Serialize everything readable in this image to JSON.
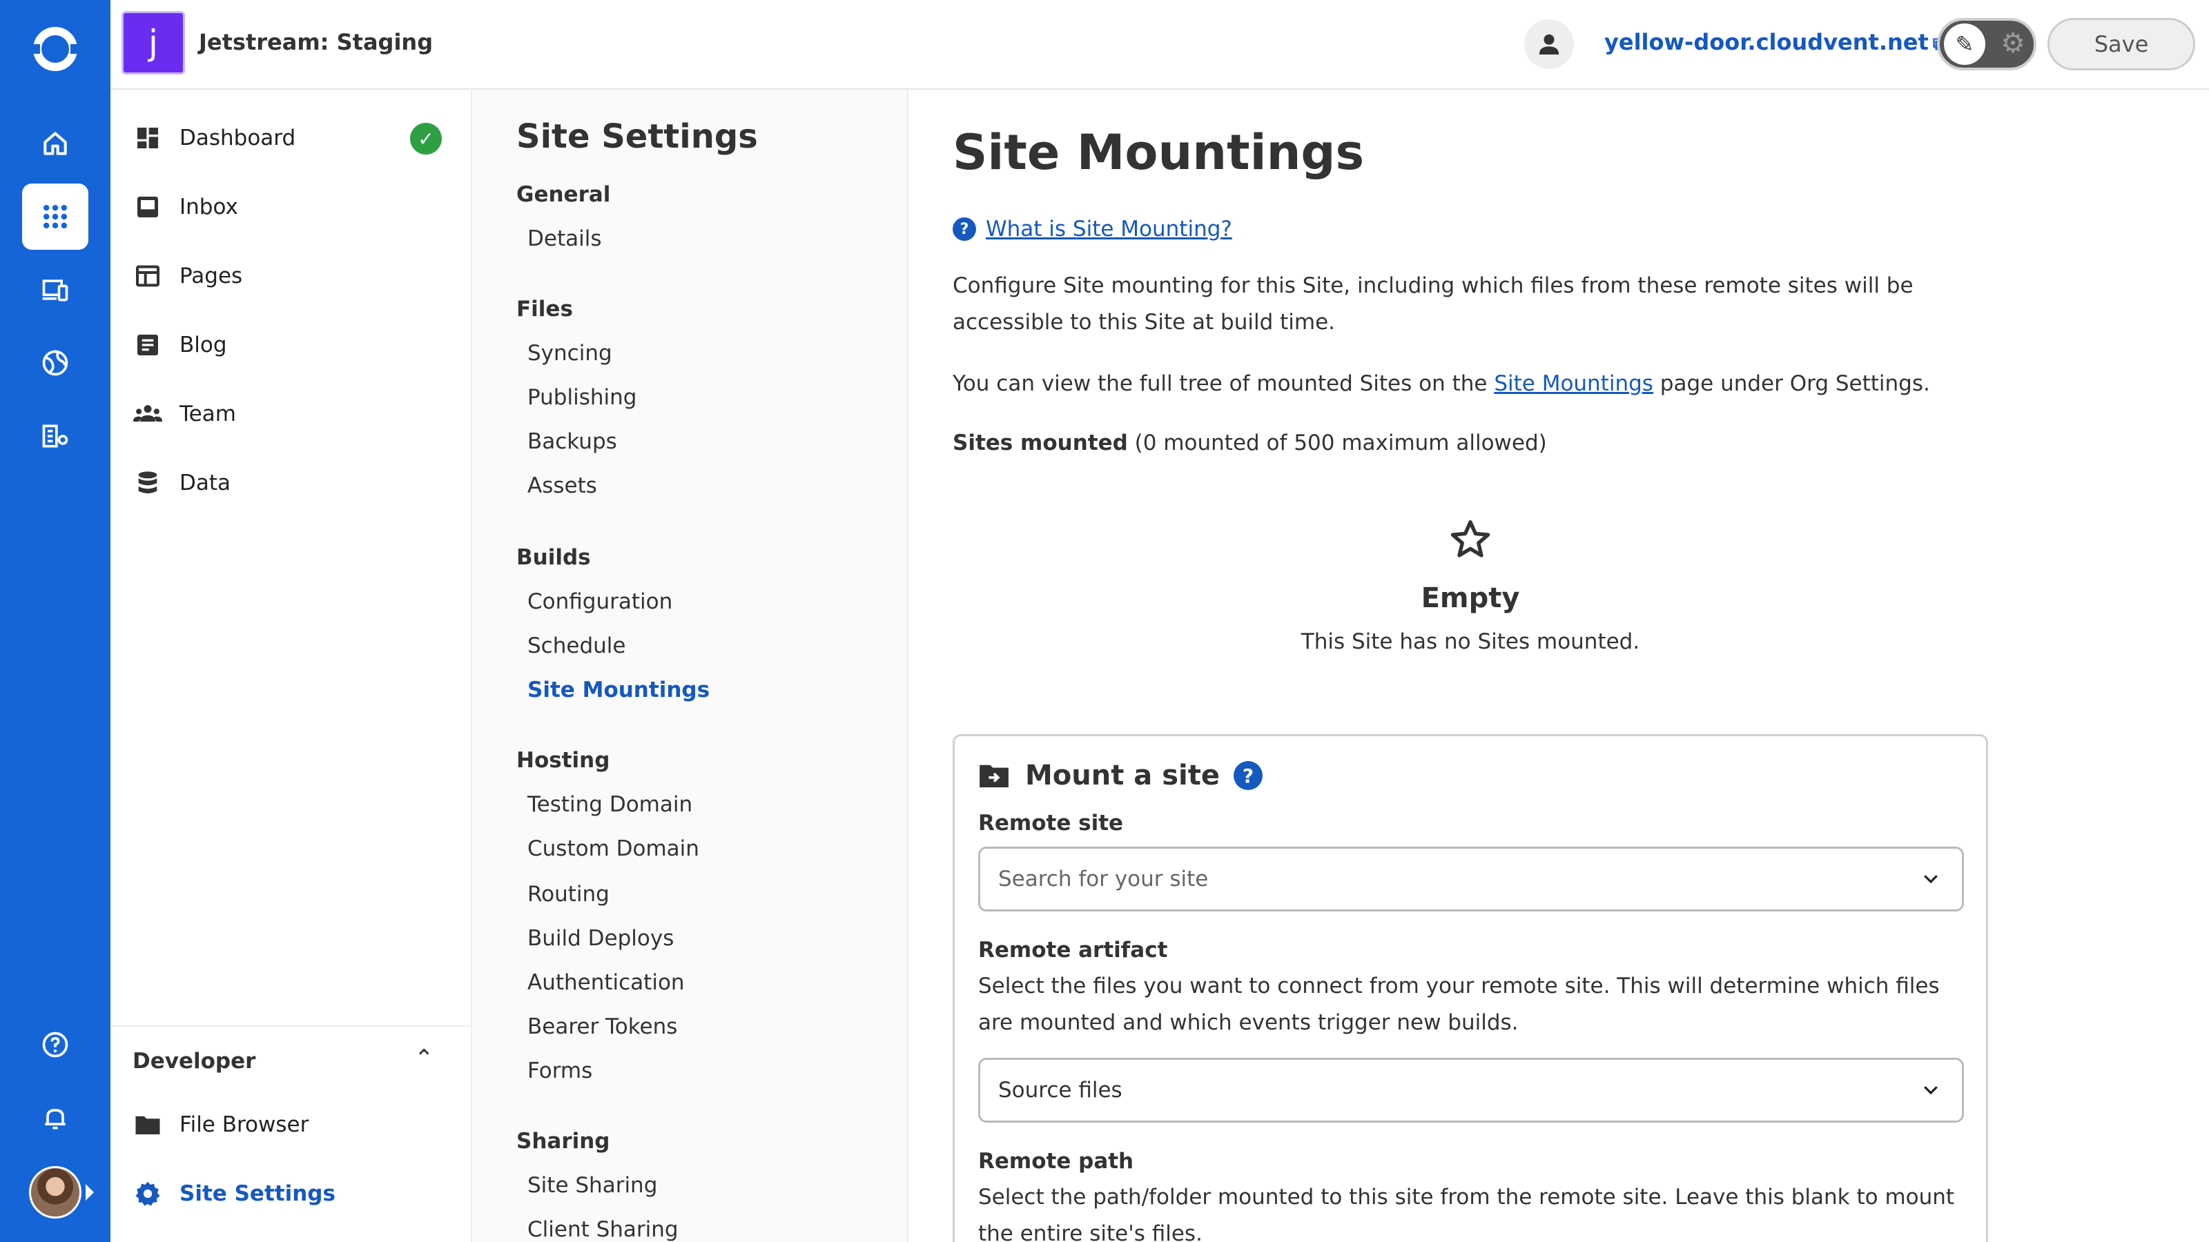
{
  "colors": {
    "brand": "#1565d8",
    "link": "#1558c0",
    "success": "#2ea043",
    "site_badge": "#6a2df0"
  },
  "rail": {
    "icons": [
      "logo-icon",
      "home-icon",
      "apps-grid-icon",
      "devices-icon",
      "globe-icon",
      "org-settings-icon",
      "help-icon",
      "bell-icon"
    ]
  },
  "topbar": {
    "site_initial": "j",
    "site_name": "Jetstream: Staging",
    "domain": "yellow-door.cloudvent.net",
    "save_label": "Save"
  },
  "nav1": {
    "items": [
      {
        "label": "Dashboard",
        "icon": "dashboard-icon"
      },
      {
        "label": "Inbox",
        "icon": "inbox-icon"
      },
      {
        "label": "Pages",
        "icon": "pages-icon"
      },
      {
        "label": "Blog",
        "icon": "blog-icon"
      },
      {
        "label": "Team",
        "icon": "team-icon"
      },
      {
        "label": "Data",
        "icon": "database-icon"
      }
    ],
    "developer": {
      "header": "Developer",
      "items": [
        {
          "label": "File Browser",
          "icon": "folder-icon"
        },
        {
          "label": "Site Settings",
          "icon": "gear-icon"
        }
      ]
    }
  },
  "nav2": {
    "title": "Site Settings",
    "groups": [
      {
        "label": "General",
        "links": [
          "Details"
        ]
      },
      {
        "label": "Files",
        "links": [
          "Syncing",
          "Publishing",
          "Backups",
          "Assets"
        ]
      },
      {
        "label": "Builds",
        "links": [
          "Configuration",
          "Schedule",
          "Site Mountings"
        ]
      },
      {
        "label": "Hosting",
        "links": [
          "Testing Domain",
          "Custom Domain",
          "Routing",
          "Build Deploys",
          "Authentication",
          "Bearer Tokens",
          "Forms"
        ]
      },
      {
        "label": "Sharing",
        "links": [
          "Site Sharing",
          "Client Sharing"
        ]
      }
    ]
  },
  "main": {
    "title": "Site Mountings",
    "help_link": "What is Site Mounting?",
    "intro": "Configure Site mounting for this Site, including which files from these remote sites will be accessible to this Site at build time.",
    "view_prefix": "You can view the full tree of mounted Sites on the ",
    "view_link": "Site Mountings",
    "view_suffix": " page under Org Settings.",
    "sites_mounted_label": "Sites mounted",
    "sites_mounted_detail": " (0 mounted of 500 maximum allowed)",
    "empty_title": "Empty",
    "empty_sub": "This Site has no Sites mounted.",
    "mount": {
      "title": "Mount a site",
      "remote_site_label": "Remote site",
      "remote_site_placeholder": "Search for your site",
      "remote_artifact_label": "Remote artifact",
      "remote_artifact_desc": "Select the files you want to connect from your remote site. This will determine which files are mounted and which events trigger new builds.",
      "remote_artifact_value": "Source files",
      "remote_path_label": "Remote path",
      "remote_path_desc": "Select the path/folder mounted to this site from the remote site. Leave this blank to mount the entire site's files."
    }
  }
}
